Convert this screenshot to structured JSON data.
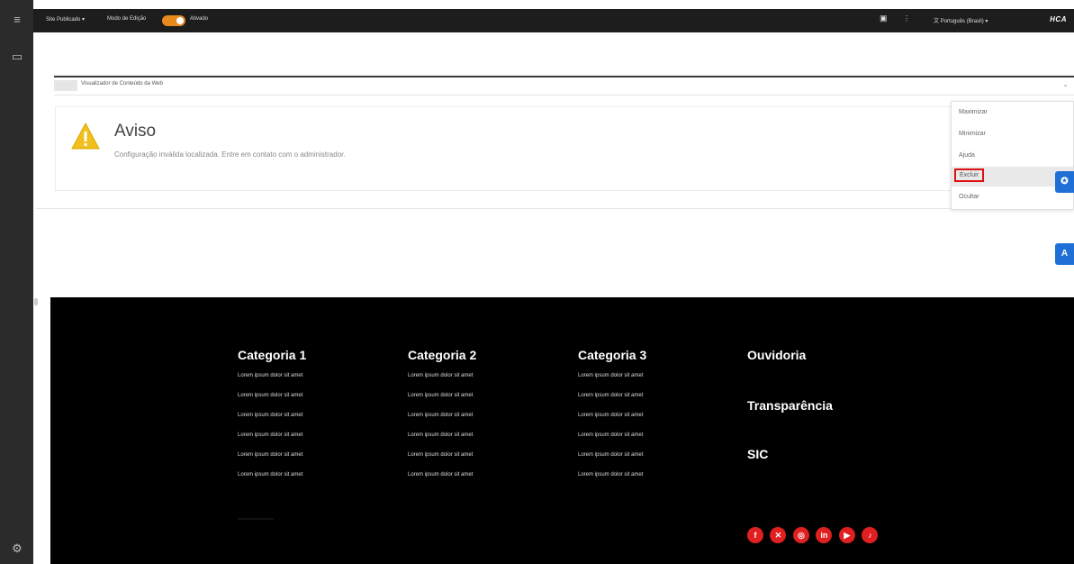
{
  "topbar": {
    "site_label": "Site Publicado",
    "site_caret": "▾",
    "mode_label": "Modo de Edição",
    "mode_state": "Ativado",
    "language": "Português (Brasil)",
    "language_caret": "▾",
    "brand": "HCA"
  },
  "portlet": {
    "title": "Visualizador de Conteúdo da Web",
    "chevron": "⌄"
  },
  "alert": {
    "title": "Aviso",
    "description": "Configuração inválida localizada. Entre em contato com o administrador."
  },
  "menu": {
    "items": [
      "Maximizar",
      "Minimizar",
      "Ajuda",
      "Excluir",
      "Ocultar"
    ],
    "highlighted": "Excluir"
  },
  "footer": {
    "columns": [
      {
        "title": "Categoria 1",
        "links": [
          "Lorem ipsum dolor sit amet",
          "Lorem ipsum dolor sit amet",
          "Lorem ipsum dolor sit amet",
          "Lorem ipsum dolor sit amet",
          "Lorem ipsum dolor sit amet",
          "Lorem ipsum dolor sit amet"
        ]
      },
      {
        "title": "Categoria 2",
        "links": [
          "Lorem ipsum dolor sit amet",
          "Lorem ipsum dolor sit amet",
          "Lorem ipsum dolor sit amet",
          "Lorem ipsum dolor sit amet",
          "Lorem ipsum dolor sit amet",
          "Lorem ipsum dolor sit amet"
        ]
      },
      {
        "title": "Categoria 3",
        "links": [
          "Lorem ipsum dolor sit amet",
          "Lorem ipsum dolor sit amet",
          "Lorem ipsum dolor sit amet",
          "Lorem ipsum dolor sit amet",
          "Lorem ipsum dolor sit amet",
          "Lorem ipsum dolor sit amet"
        ]
      }
    ],
    "ext_links": [
      "Ouvidoria",
      "Transparência",
      "SIC"
    ],
    "social": [
      {
        "name": "facebook-icon",
        "glyph": "f"
      },
      {
        "name": "x-icon",
        "glyph": "✕"
      },
      {
        "name": "instagram-icon",
        "glyph": "◎"
      },
      {
        "name": "linkedin-icon",
        "glyph": "in"
      },
      {
        "name": "youtube-icon",
        "glyph": "▶"
      },
      {
        "name": "tiktok-icon",
        "glyph": "♪"
      }
    ]
  },
  "side_buttons": [
    {
      "name": "accessibility-icon",
      "glyph": "✪"
    },
    {
      "name": "translate-icon",
      "glyph": "A"
    }
  ],
  "colors": {
    "accent_orange": "#e8891c",
    "highlight_red": "#dd1111",
    "social_red": "#e02020",
    "side_blue": "#1f6fd6"
  }
}
